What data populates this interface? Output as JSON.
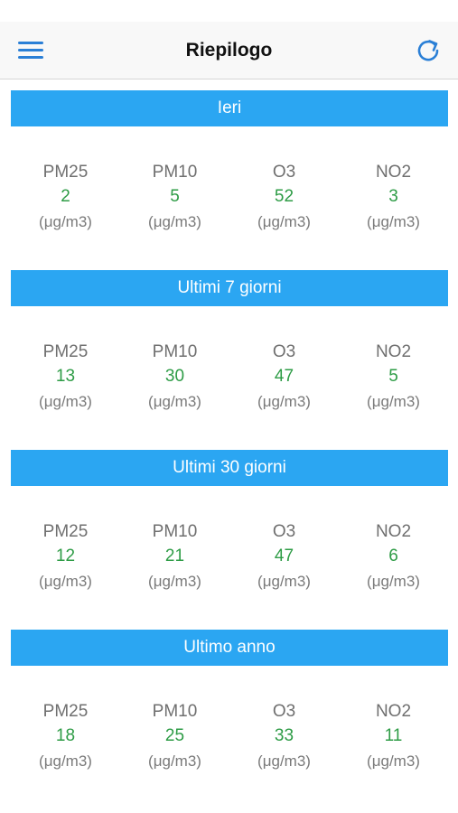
{
  "header": {
    "title": "Riepilogo"
  },
  "icons": {
    "menu": "menu-icon",
    "refresh": "refresh-icon"
  },
  "colors": {
    "accent": "#2ba6f2",
    "value": "#2e9c46",
    "nav_icon": "#2a7fd6"
  },
  "sections": [
    {
      "title": "Ieri",
      "metrics": [
        {
          "name": "PM25",
          "value": "2",
          "unit": "(μg/m3)"
        },
        {
          "name": "PM10",
          "value": "5",
          "unit": "(μg/m3)"
        },
        {
          "name": "O3",
          "value": "52",
          "unit": "(μg/m3)"
        },
        {
          "name": "NO2",
          "value": "3",
          "unit": "(μg/m3)"
        }
      ]
    },
    {
      "title": "Ultimi 7 giorni",
      "metrics": [
        {
          "name": "PM25",
          "value": "13",
          "unit": "(μg/m3)"
        },
        {
          "name": "PM10",
          "value": "30",
          "unit": "(μg/m3)"
        },
        {
          "name": "O3",
          "value": "47",
          "unit": "(μg/m3)"
        },
        {
          "name": "NO2",
          "value": "5",
          "unit": "(μg/m3)"
        }
      ]
    },
    {
      "title": "Ultimi 30 giorni",
      "metrics": [
        {
          "name": "PM25",
          "value": "12",
          "unit": "(μg/m3)"
        },
        {
          "name": "PM10",
          "value": "21",
          "unit": "(μg/m3)"
        },
        {
          "name": "O3",
          "value": "47",
          "unit": "(μg/m3)"
        },
        {
          "name": "NO2",
          "value": "6",
          "unit": "(μg/m3)"
        }
      ]
    },
    {
      "title": "Ultimo anno",
      "metrics": [
        {
          "name": "PM25",
          "value": "18",
          "unit": "(μg/m3)"
        },
        {
          "name": "PM10",
          "value": "25",
          "unit": "(μg/m3)"
        },
        {
          "name": "O3",
          "value": "33",
          "unit": "(μg/m3)"
        },
        {
          "name": "NO2",
          "value": "11",
          "unit": "(μg/m3)"
        }
      ]
    }
  ]
}
